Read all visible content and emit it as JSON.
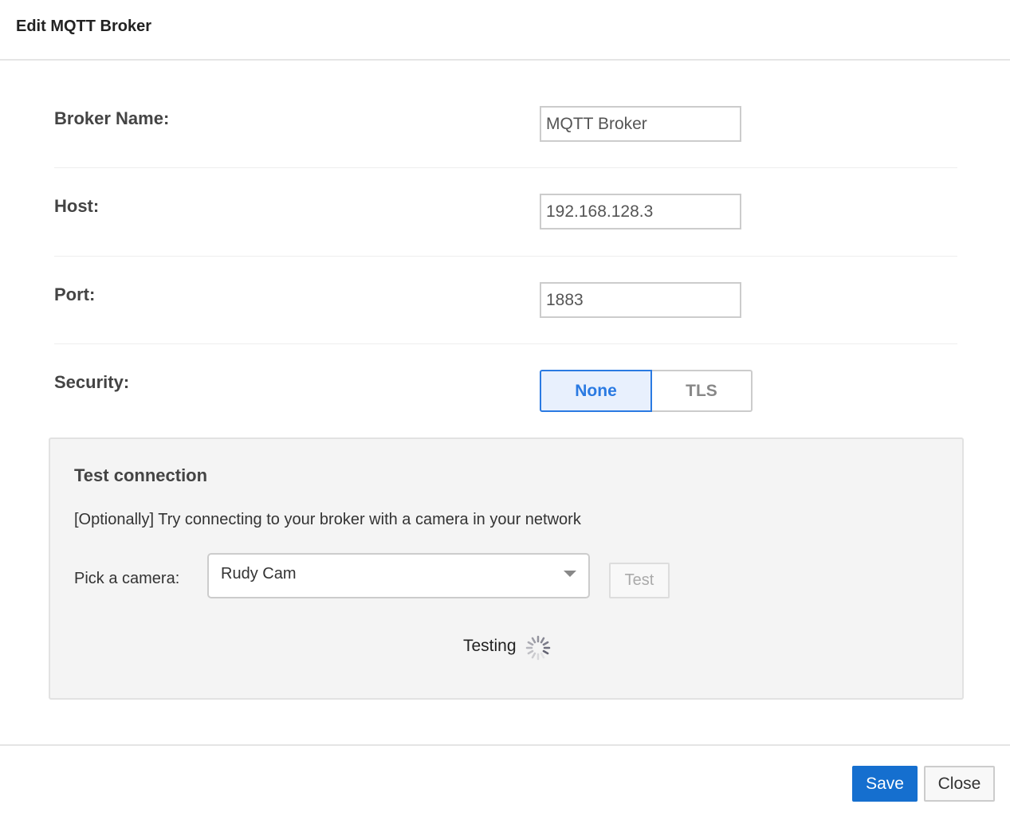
{
  "dialog": {
    "title": "Edit MQTT Broker"
  },
  "form": {
    "broker_name": {
      "label": "Broker Name:",
      "value": "MQTT Broker"
    },
    "host": {
      "label": "Host:",
      "value": "192.168.128.3"
    },
    "port": {
      "label": "Port:",
      "value": "1883"
    },
    "security": {
      "label": "Security:",
      "options": [
        "None",
        "TLS"
      ],
      "selected": "None"
    }
  },
  "test_connection": {
    "title": "Test connection",
    "description": "[Optionally] Try connecting to your broker with a camera in your network",
    "pick_label": "Pick a camera:",
    "camera": "Rudy Cam",
    "test_label": "Test",
    "status": "Testing"
  },
  "footer": {
    "save_label": "Save",
    "close_label": "Close"
  },
  "colors": {
    "accent": "#156fcf",
    "selected_blue": "#2a7ae2"
  }
}
